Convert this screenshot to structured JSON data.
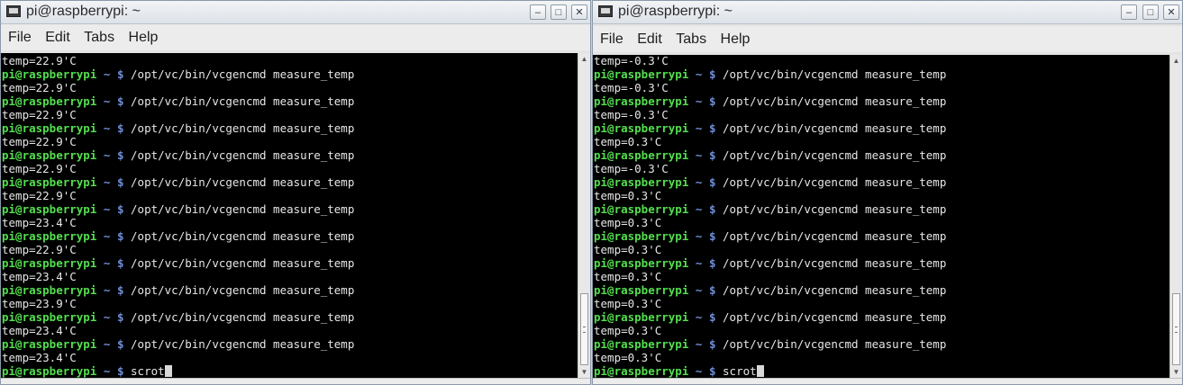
{
  "windows": [
    {
      "title": "pi@raspberrypi: ~",
      "menu": [
        "File",
        "Edit",
        "Tabs",
        "Help"
      ],
      "controls": {
        "minimize": "–",
        "maximize": "□",
        "close": "✕"
      },
      "prompt": {
        "user": "pi@raspberrypi",
        "dir": "~",
        "symbol": "$"
      },
      "lines": [
        {
          "type": "output",
          "text": "temp=22.9'C"
        },
        {
          "type": "command",
          "text": "/opt/vc/bin/vcgencmd measure_temp"
        },
        {
          "type": "output",
          "text": "temp=22.9'C"
        },
        {
          "type": "command",
          "text": "/opt/vc/bin/vcgencmd measure_temp"
        },
        {
          "type": "output",
          "text": "temp=22.9'C"
        },
        {
          "type": "command",
          "text": "/opt/vc/bin/vcgencmd measure_temp"
        },
        {
          "type": "output",
          "text": "temp=22.9'C"
        },
        {
          "type": "command",
          "text": "/opt/vc/bin/vcgencmd measure_temp"
        },
        {
          "type": "output",
          "text": "temp=22.9'C"
        },
        {
          "type": "command",
          "text": "/opt/vc/bin/vcgencmd measure_temp"
        },
        {
          "type": "output",
          "text": "temp=22.9'C"
        },
        {
          "type": "command",
          "text": "/opt/vc/bin/vcgencmd measure_temp"
        },
        {
          "type": "output",
          "text": "temp=23.4'C"
        },
        {
          "type": "command",
          "text": "/opt/vc/bin/vcgencmd measure_temp"
        },
        {
          "type": "output",
          "text": "temp=22.9'C"
        },
        {
          "type": "command",
          "text": "/opt/vc/bin/vcgencmd measure_temp"
        },
        {
          "type": "output",
          "text": "temp=23.4'C"
        },
        {
          "type": "command",
          "text": "/opt/vc/bin/vcgencmd measure_temp"
        },
        {
          "type": "output",
          "text": "temp=23.9'C"
        },
        {
          "type": "command",
          "text": "/opt/vc/bin/vcgencmd measure_temp"
        },
        {
          "type": "output",
          "text": "temp=23.4'C"
        },
        {
          "type": "command",
          "text": "/opt/vc/bin/vcgencmd measure_temp"
        },
        {
          "type": "output",
          "text": "temp=23.4'C"
        },
        {
          "type": "current",
          "text": "scrot"
        }
      ]
    },
    {
      "title": "pi@raspberrypi: ~",
      "menu": [
        "File",
        "Edit",
        "Tabs",
        "Help"
      ],
      "controls": {
        "minimize": "–",
        "maximize": "□",
        "close": "✕"
      },
      "prompt": {
        "user": "pi@raspberrypi",
        "dir": "~",
        "symbol": "$"
      },
      "lines": [
        {
          "type": "output",
          "text": "temp=-0.3'C"
        },
        {
          "type": "command",
          "text": "/opt/vc/bin/vcgencmd measure_temp"
        },
        {
          "type": "output",
          "text": "temp=-0.3'C"
        },
        {
          "type": "command",
          "text": "/opt/vc/bin/vcgencmd measure_temp"
        },
        {
          "type": "output",
          "text": "temp=-0.3'C"
        },
        {
          "type": "command",
          "text": "/opt/vc/bin/vcgencmd measure_temp"
        },
        {
          "type": "output",
          "text": "temp=0.3'C"
        },
        {
          "type": "command",
          "text": "/opt/vc/bin/vcgencmd measure_temp"
        },
        {
          "type": "output",
          "text": "temp=-0.3'C"
        },
        {
          "type": "command",
          "text": "/opt/vc/bin/vcgencmd measure_temp"
        },
        {
          "type": "output",
          "text": "temp=0.3'C"
        },
        {
          "type": "command",
          "text": "/opt/vc/bin/vcgencmd measure_temp"
        },
        {
          "type": "output",
          "text": "temp=0.3'C"
        },
        {
          "type": "command",
          "text": "/opt/vc/bin/vcgencmd measure_temp"
        },
        {
          "type": "output",
          "text": "temp=0.3'C"
        },
        {
          "type": "command",
          "text": "/opt/vc/bin/vcgencmd measure_temp"
        },
        {
          "type": "output",
          "text": "temp=0.3'C"
        },
        {
          "type": "command",
          "text": "/opt/vc/bin/vcgencmd measure_temp"
        },
        {
          "type": "output",
          "text": "temp=0.3'C"
        },
        {
          "type": "command",
          "text": "/opt/vc/bin/vcgencmd measure_temp"
        },
        {
          "type": "output",
          "text": "temp=0.3'C"
        },
        {
          "type": "command",
          "text": "/opt/vc/bin/vcgencmd measure_temp"
        },
        {
          "type": "output",
          "text": "temp=0.3'C"
        },
        {
          "type": "current",
          "text": "scrot"
        }
      ]
    }
  ],
  "colors": {
    "prompt_user": "#53df4d",
    "prompt_dir": "#6f8fd8",
    "terminal_bg": "#000000",
    "terminal_fg": "#e6e6e6"
  },
  "icons": {
    "window_icon": "terminal-icon",
    "scroll_up": "▲",
    "scroll_down": "▼"
  }
}
